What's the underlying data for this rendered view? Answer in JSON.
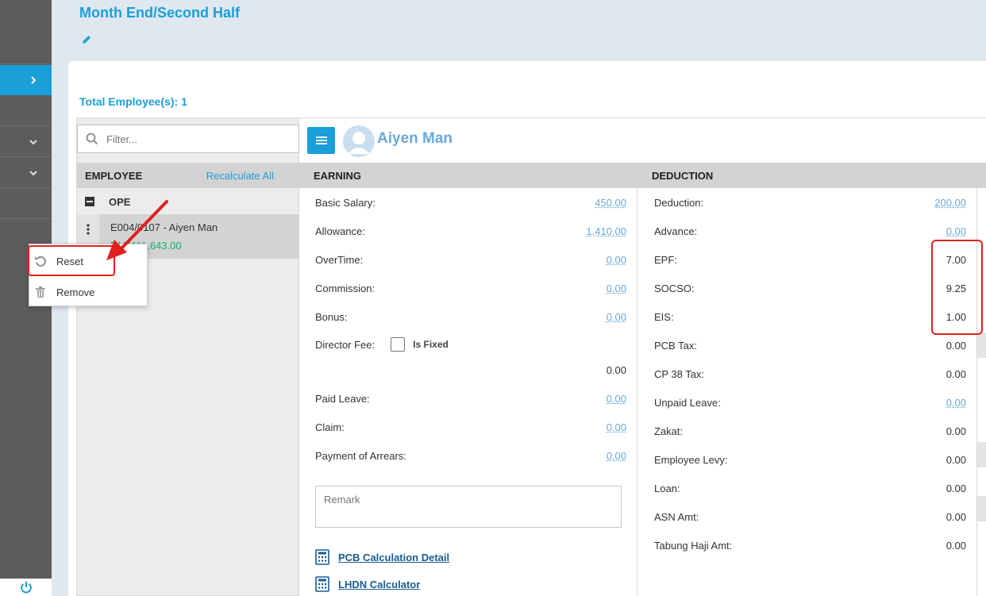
{
  "header": {
    "title": "Month End/Second Half",
    "total_employees": "Total Employee(s): 1"
  },
  "employee_list": {
    "filter_placeholder": "Filter...",
    "column_label": "EMPLOYEE",
    "recalculate_label": "Recalculate All",
    "group_name": "OPE",
    "employee": {
      "name": "E004/0107 - Aiyen Man",
      "amount": "RM1111,643.00"
    }
  },
  "context_menu": {
    "reset_label": "Reset",
    "remove_label": "Remove"
  },
  "employee_detail": {
    "name": "Aiyen Man"
  },
  "earning": {
    "heading": "EARNING",
    "basic_salary": {
      "label": "Basic Salary:",
      "value": "450.00"
    },
    "allowance": {
      "label": "Allowance:",
      "value": "1,410.00"
    },
    "overtime": {
      "label": "OverTime:",
      "value": "0.00"
    },
    "commission": {
      "label": "Commission:",
      "value": "0.00"
    },
    "bonus": {
      "label": "Bonus:",
      "value": "0.00"
    },
    "director_fee": {
      "label": "Director Fee:",
      "is_fixed_label": "Is Fixed",
      "value": "0.00"
    },
    "paid_leave": {
      "label": "Paid Leave:",
      "value": "0.00"
    },
    "claim": {
      "label": "Claim:",
      "value": "0.00"
    },
    "payment_of_arrears": {
      "label": "Payment of Arrears:",
      "value": "0.00"
    },
    "remark_placeholder": "Remark",
    "pcb_calc_label": "PCB Calculation Detail",
    "lhdn_calc_label": "LHDN Calculator"
  },
  "deduction": {
    "heading": "DEDUCTION",
    "deduction": {
      "label": "Deduction:",
      "value": "200.00"
    },
    "advance": {
      "label": "Advance:",
      "value": "0.00"
    },
    "epf": {
      "label": "EPF:",
      "value": "7.00"
    },
    "socso": {
      "label": "SOCSO:",
      "value": "9.25"
    },
    "eis": {
      "label": "EIS:",
      "value": "1.00"
    },
    "pcb_tax": {
      "label": "PCB Tax:",
      "value": "0.00"
    },
    "cp38_tax": {
      "label": "CP 38 Tax:",
      "value": "0.00"
    },
    "unpaid_leave": {
      "label": "Unpaid Leave:",
      "value": "0.00"
    },
    "zakat": {
      "label": "Zakat:",
      "value": "0.00"
    },
    "employee_levy": {
      "label": "Employee Levy:",
      "value": "0.00"
    },
    "loan": {
      "label": "Loan:",
      "value": "0.00"
    },
    "asn_amt": {
      "label": "ASN Amt:",
      "value": "0.00"
    },
    "tabung_haji_amt": {
      "label": "Tabung Haji Amt:",
      "value": "0.00"
    }
  },
  "colors": {
    "accent": "#1a9fd9",
    "name_blue": "#6aa8d8",
    "amount_green": "#17b26a",
    "annotation_red": "#e02020",
    "sidebar": "#5c5c5c"
  }
}
